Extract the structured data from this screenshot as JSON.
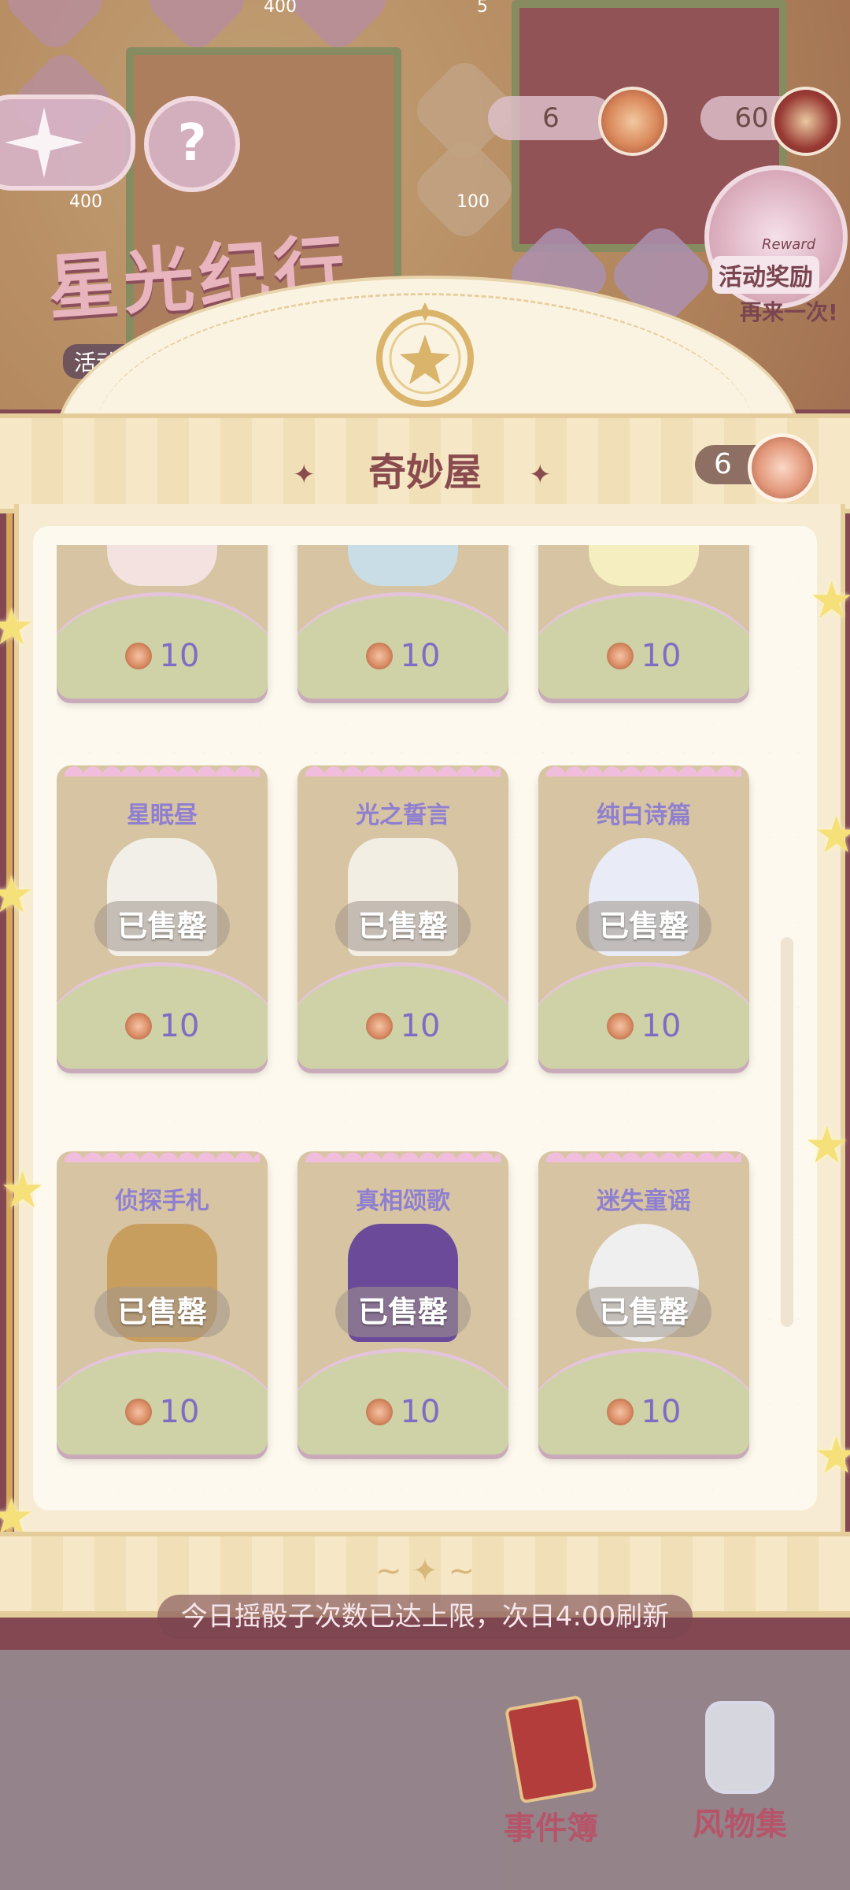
{
  "hud": {
    "coin_count": "6",
    "badge_count": "60",
    "help_icon": "?",
    "event_title": "星光纪行",
    "event_tip": "活动剩",
    "reward_label": "活动奖励",
    "reward_sub": "再来一次!",
    "reward_small": "Reward",
    "tile_value_1": "400",
    "tile_value_2": "100",
    "tile_value_3": "400",
    "tile_value_4": "5"
  },
  "shop": {
    "title": "奇妙屋",
    "currency": "6",
    "sold_label": "已售罄",
    "items": [
      {
        "name": "",
        "price": "10",
        "sold": false,
        "color": "#f4e2e0"
      },
      {
        "name": "",
        "price": "10",
        "sold": false,
        "color": "#c9dde6"
      },
      {
        "name": "",
        "price": "10",
        "sold": false,
        "color": "#f5eec0"
      },
      {
        "name": "星眠昼",
        "price": "10",
        "sold": true,
        "color": "#f2efe8"
      },
      {
        "name": "光之誓言",
        "price": "10",
        "sold": true,
        "color": "#f2eee4"
      },
      {
        "name": "纯白诗篇",
        "price": "10",
        "sold": true,
        "color": "#e9ecf6"
      },
      {
        "name": "侦探手札",
        "price": "10",
        "sold": true,
        "color": "#c89e5e"
      },
      {
        "name": "真相颂歌",
        "price": "10",
        "sold": true,
        "color": "#6b4a9a"
      },
      {
        "name": "迷失童谣",
        "price": "10",
        "sold": true,
        "color": "#efefef"
      }
    ]
  },
  "notice": "今日摇骰子次数已达上限，次日4:00刷新",
  "bottom": {
    "events_label": "事件簿",
    "collection_label": "风物集"
  },
  "colors": {
    "accent": "#8a4b4f",
    "name_text": "#8f7fd0",
    "price_text": "#7f6cc4"
  }
}
